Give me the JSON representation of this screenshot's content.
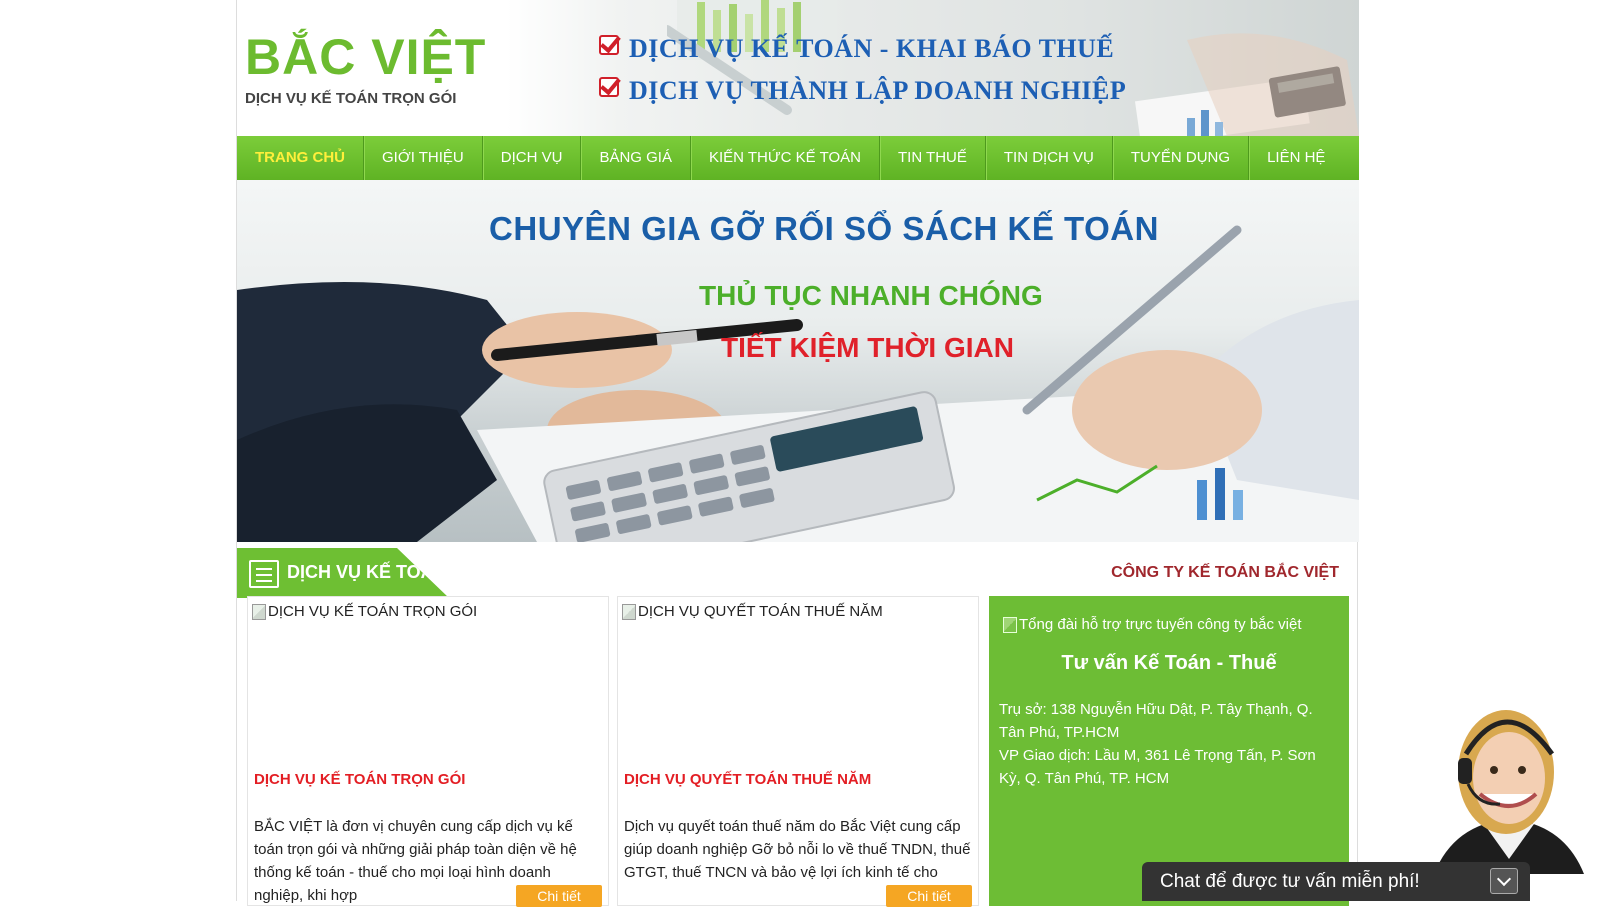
{
  "header": {
    "logo_main": "BẮC VIỆT",
    "logo_sub": "DỊCH VỤ KẾ TOÁN TRỌN GÓI",
    "slogans": [
      "DỊCH VỤ KẾ TOÁN - KHAI BÁO THUẾ",
      "DỊCH VỤ THÀNH LẬP DOANH NGHIỆP"
    ]
  },
  "nav": {
    "items": [
      {
        "label": "TRANG CHỦ",
        "active": true
      },
      {
        "label": "GIỚI THIỆU"
      },
      {
        "label": "DỊCH VỤ"
      },
      {
        "label": "BẢNG GIÁ"
      },
      {
        "label": "KIẾN THỨC KẾ TOÁN"
      },
      {
        "label": "TIN THUẾ"
      },
      {
        "label": "TIN DỊCH VỤ"
      },
      {
        "label": "TUYỂN DỤNG"
      },
      {
        "label": "LIÊN HỆ"
      }
    ]
  },
  "banner": {
    "line1": "CHUYÊN GIA GỠ RỐI SỔ SÁCH KẾ TOÁN",
    "line2": "THỦ TỤC NHANH CHÓNG",
    "line3": "TIẾT KIỆM THỜI GIAN"
  },
  "section": {
    "title": "DỊCH VỤ KẾ TOÁN",
    "company": "CÔNG TY KẾ TOÁN BẮC VIỆT"
  },
  "cards": [
    {
      "image_alt": "DỊCH VỤ KẾ TOÁN TRỌN GÓI",
      "title": "DỊCH VỤ KẾ TOÁN TRỌN GÓI",
      "description": "BẮC VIỆT là đơn vị chuyên cung cấp dịch vụ kế toán trọn gói và những giải pháp toàn diện về hệ thống kế toán - thuế cho mọi loại hình doanh nghiệp, khi hợp",
      "button": "Chi tiết"
    },
    {
      "image_alt": "DỊCH VỤ QUYẾT TOÁN THUẾ NĂM",
      "title": "DỊCH VỤ QUYẾT TOÁN THUẾ NĂM",
      "description": "Dịch vụ quyết toán thuế năm do Bắc Việt cung cấp giúp doanh nghiệp Gỡ bỏ nỗi lo về thuế TNDN, thuế GTGT, thuế TNCN và bảo vệ lợi ích kinh tế cho",
      "button": "Chi tiết"
    }
  ],
  "sidebox": {
    "image_alt": "Tổng đài hỗ trợ trực tuyến công ty bắc việt",
    "title": "Tư vấn Kế Toán - Thuế",
    "address": "Trụ sở: 138 Nguyễn Hữu Dật, P. Tây Thạnh, Q. Tân Phú, TP.HCM",
    "office": "VP Giao dịch: Lầu M, 361 Lê Trọng Tấn, P. Sơn Kỳ, Q. Tân Phú, TP. HCM"
  },
  "chat": {
    "label": "Chat để được tư vấn miễn phí!"
  },
  "colors": {
    "brand_green": "#6ebf33",
    "nav_active": "#ffef3b",
    "title_red": "#e31e24",
    "banner_blue": "#1a5ea8",
    "button_orange": "#f5a623"
  }
}
